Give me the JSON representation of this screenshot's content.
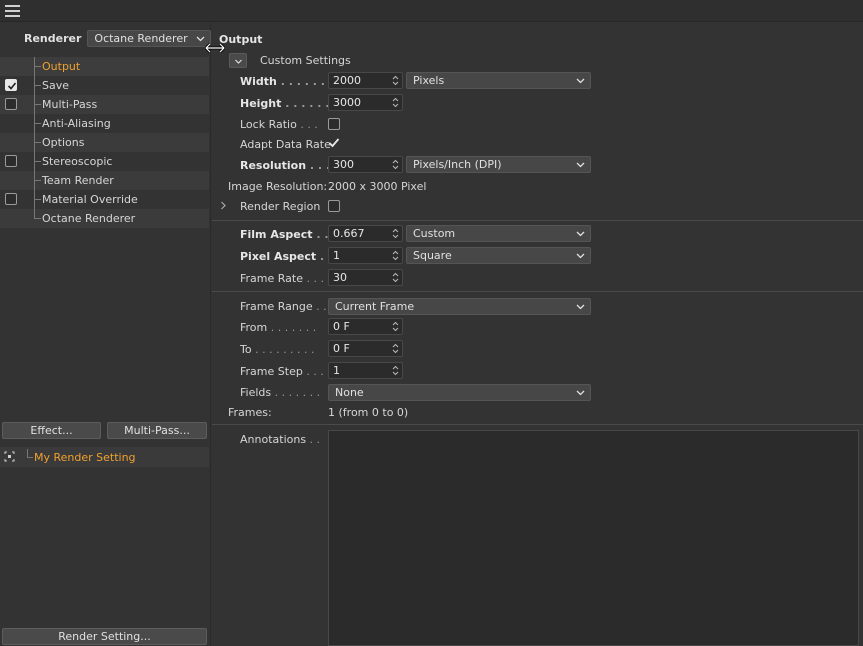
{
  "left": {
    "renderer_label": "Renderer",
    "renderer_value": "Octane Renderer",
    "tree": [
      {
        "label": "Output",
        "checkbox": "none",
        "active": true
      },
      {
        "label": "Save",
        "checkbox": "checked",
        "active": false
      },
      {
        "label": "Multi-Pass",
        "checkbox": "unchecked",
        "active": false
      },
      {
        "label": "Anti-Aliasing",
        "checkbox": "none",
        "active": false
      },
      {
        "label": "Options",
        "checkbox": "none",
        "active": false
      },
      {
        "label": "Stereoscopic",
        "checkbox": "unchecked",
        "active": false
      },
      {
        "label": "Team Render",
        "checkbox": "none",
        "active": false
      },
      {
        "label": "Material Override",
        "checkbox": "unchecked",
        "active": false
      },
      {
        "label": "Octane Renderer",
        "checkbox": "none",
        "active": false
      }
    ],
    "effect_button": "Effect...",
    "multipass_button": "Multi-Pass...",
    "render_setting_item": "My Render Setting",
    "render_setting_button": "Render Setting..."
  },
  "output": {
    "title": "Output",
    "custom_settings": "Custom Settings",
    "width_label": "Width",
    "width_dots": " . . . . . .",
    "width_value": "2000",
    "width_unit": "Pixels",
    "height_label": "Height",
    "height_dots": " . . . . . .",
    "height_value": "3000",
    "lock_ratio_label": "Lock Ratio",
    "lock_ratio_dots": " . . .",
    "lock_ratio_checked": false,
    "adapt_label": "Adapt Data Rate",
    "adapt_checked": true,
    "resolution_label": "Resolution",
    "resolution_dots": " . . .",
    "resolution_value": "300",
    "resolution_unit": "Pixels/Inch (DPI)",
    "image_resolution_label": "Image Resolution:",
    "image_resolution_value": "2000 x 3000 Pixel",
    "render_region_label": "Render Region",
    "render_region_checked": false,
    "film_aspect_label": "Film Aspect",
    "film_aspect_dots": " . .",
    "film_aspect_value": "0.667",
    "film_aspect_preset": "Custom",
    "pixel_aspect_label": "Pixel Aspect",
    "pixel_aspect_dots": " . .",
    "pixel_aspect_value": "1",
    "pixel_aspect_preset": "Square",
    "frame_rate_label": "Frame Rate",
    "frame_rate_dots": " . . .",
    "frame_rate_value": "30",
    "frame_range_label": "Frame Range",
    "frame_range_dots": " . .",
    "frame_range_value": "Current Frame",
    "from_label": "From",
    "from_dots": " . . . . . . .",
    "from_value": "0 F",
    "to_label": "To",
    "to_dots": " . . . . . . . . .",
    "to_value": "0 F",
    "frame_step_label": "Frame Step",
    "frame_step_dots": " . . .",
    "frame_step_value": "1",
    "fields_label": "Fields",
    "fields_dots": " . . . . . . .",
    "fields_value": "None",
    "frames_label": "Frames:",
    "frames_value": "1 (from 0 to 0)",
    "annotations_label": "Annotations",
    "annotations_dots": " . .",
    "annotations_value": ""
  },
  "colors": {
    "background": "#333333",
    "accent": "#f0a030",
    "field": "#2b2b2b"
  }
}
